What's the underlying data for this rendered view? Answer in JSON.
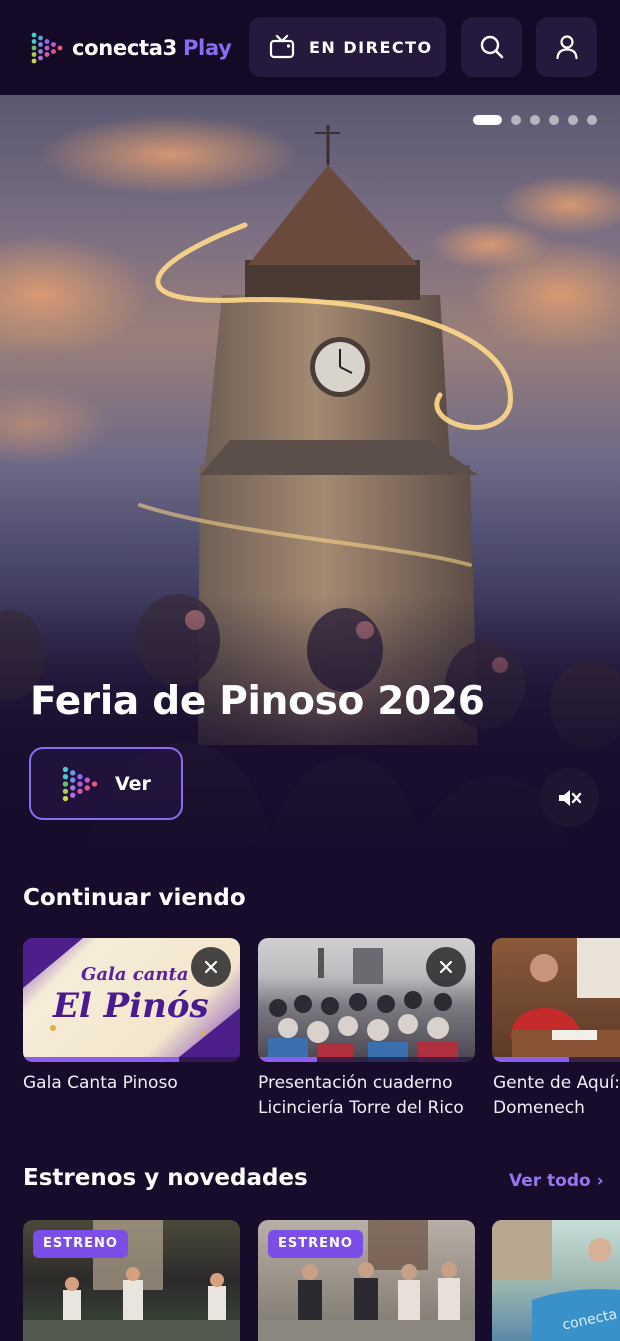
{
  "header": {
    "logo_text": "conecta3",
    "logo_play": "Play",
    "live_label": "EN DIRECTO",
    "icons": {
      "live": "tv-icon",
      "search": "search-icon",
      "account": "user-icon"
    }
  },
  "hero": {
    "title": "Feria de Pinoso 2026",
    "watch_label": "Ver",
    "slides_total": 6,
    "slide_active": 1,
    "mute_icon": "volume-mute-icon"
  },
  "continue_watching": {
    "title": "Continuar viendo",
    "items": [
      {
        "title": "Gala Canta Pinoso",
        "thumb_text_1": "Gala canta",
        "thumb_text_2": "El Pinós",
        "progress": 0.72
      },
      {
        "title": "Presentación cuaderno Licinciería Torre del Rico",
        "progress": 0.27
      },
      {
        "title": "Gente de Aquí: Domenech",
        "progress": 0.6
      }
    ]
  },
  "new_releases": {
    "title": "Estrenos y novedades",
    "see_all": "Ver todo ›",
    "badge": "ESTRENO",
    "items": [
      {
        "badge": "ESTRENO"
      },
      {
        "badge": "ESTRENO"
      },
      {
        "thumb_text": "conecta"
      }
    ]
  },
  "colors": {
    "background": "#170c2b",
    "accent": "#8c6cf0",
    "header": "#140a26"
  }
}
